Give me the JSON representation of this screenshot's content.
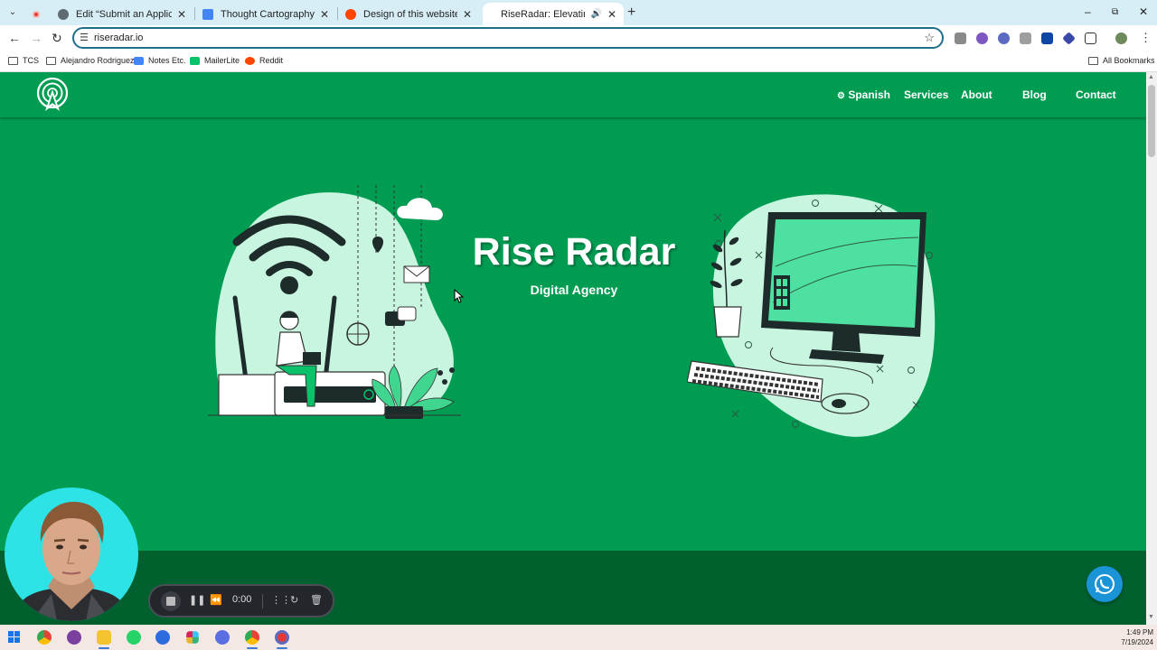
{
  "browser": {
    "tabs": [
      {
        "title": "Edit “Submit an Application” w",
        "active": false
      },
      {
        "title": "Thought Cartography - Calend",
        "active": false
      },
      {
        "title": "Design of this website : r/webs",
        "active": false
      },
      {
        "title": "RiseRadar: Elevating Your D",
        "active": true
      }
    ],
    "url": "riseradar.io",
    "bookmarks": [
      "TCS",
      "Alejandro Rodriguez",
      "Notes Etc.",
      "MailerLite",
      "Reddit"
    ],
    "all_bookmarks": "All Bookmarks"
  },
  "site": {
    "nav": {
      "spanish": "Spanish",
      "services": "Services",
      "about": "About",
      "blog": "Blog",
      "contact": "Contact"
    },
    "hero": {
      "title": "Rise Radar",
      "subtitle": "Digital Agency"
    }
  },
  "recorder": {
    "time": "0:00"
  },
  "taskbar": {
    "time": "1:49 PM",
    "date": "7/19/2024"
  },
  "colors": {
    "brand_green": "#009c52",
    "dark_green": "#00612f",
    "mint": "#c8f5e0",
    "whatsapp_blue": "#1a94d6"
  }
}
